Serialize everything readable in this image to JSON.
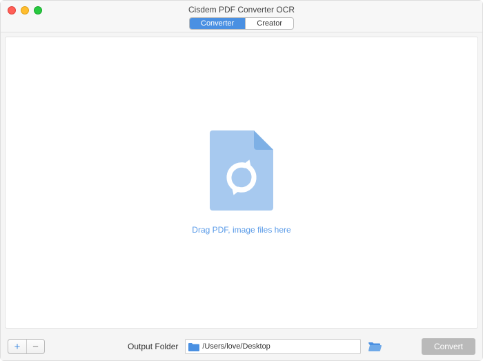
{
  "window": {
    "title": "Cisdem PDF Converter OCR"
  },
  "tabs": {
    "converter": "Converter",
    "creator": "Creator"
  },
  "dropzone": {
    "hint": "Drag PDF, image files here"
  },
  "footer": {
    "output_label": "Output Folder",
    "output_path": "/Users/love/Desktop",
    "convert_label": "Convert"
  }
}
